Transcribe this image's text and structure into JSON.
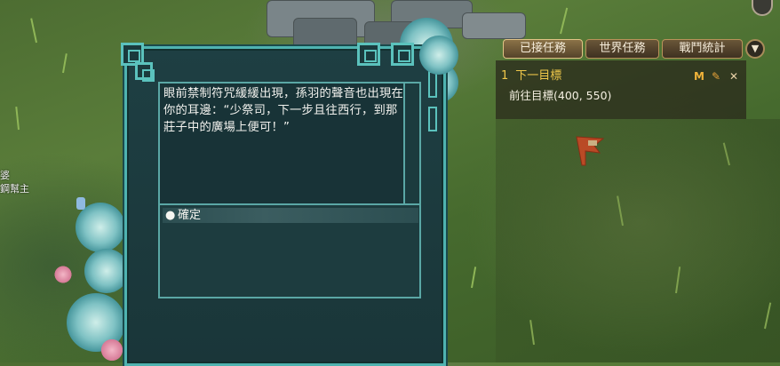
{
  "dialog": {
    "story_text": "眼前禁制符咒緩緩出現，孫羽的聲音也出現在你的耳邊：“少祭司，下一步且往西行，到那莊子中的廣場上便可！”",
    "choices": [
      {
        "bullet": "●",
        "label": "確定"
      }
    ]
  },
  "quest_tracker": {
    "tabs": [
      {
        "label": "已接任務",
        "active": true
      },
      {
        "label": "世界任務",
        "active": false
      },
      {
        "label": "戰鬥統計",
        "active": false
      }
    ],
    "collapse_icon": "chevron-down-icon",
    "quest": {
      "index": "1",
      "title": "下一目標",
      "target": "前往目標(400, 550)"
    },
    "icons": [
      {
        "name": "map-marker-icon",
        "glyph": "M"
      },
      {
        "name": "auto-path-icon",
        "glyph": "✎"
      },
      {
        "name": "close-icon",
        "glyph": "✕"
      }
    ]
  },
  "npc_label": {
    "line1": "婆",
    "line2": "鋼幫主"
  },
  "colors": {
    "dialog_border": "#4fb3b0",
    "dialog_bg": "#1e3f43",
    "quest_title": "#f0c84a",
    "tab_border": "#b9925a"
  }
}
